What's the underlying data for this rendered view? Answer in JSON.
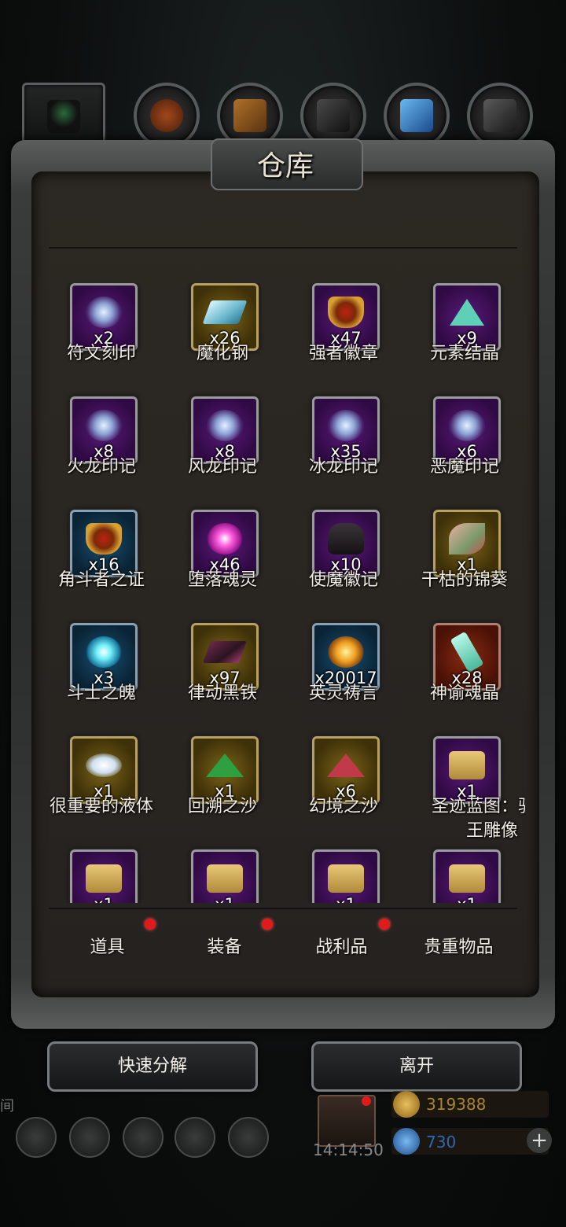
{
  "header": {
    "title": "仓库"
  },
  "top_tabs": [
    {
      "icon": "hooded-figure-icon"
    },
    {
      "icon": "leather-icon"
    },
    {
      "icon": "wood-icon"
    },
    {
      "icon": "iron-icon"
    },
    {
      "icon": "crystal-icon"
    },
    {
      "icon": "steel-icon"
    }
  ],
  "items": [
    {
      "name": "符文刻印",
      "count": "x2",
      "frame": "purple",
      "icon": "swirl"
    },
    {
      "name": "魔化钢",
      "count": "x26",
      "frame": "gold",
      "icon": "ingot"
    },
    {
      "name": "强者徽章",
      "count": "x47",
      "frame": "purple",
      "icon": "badge"
    },
    {
      "name": "元素结晶",
      "count": "x9",
      "frame": "purple",
      "icon": "pyramid"
    },
    {
      "name": "火龙印记",
      "count": "x8",
      "frame": "purple",
      "icon": "swirl"
    },
    {
      "name": "风龙印记",
      "count": "x8",
      "frame": "purple",
      "icon": "swirl"
    },
    {
      "name": "冰龙印记",
      "count": "x35",
      "frame": "purple",
      "icon": "swirl"
    },
    {
      "name": "恶魔印记",
      "count": "x6",
      "frame": "purple",
      "icon": "swirl"
    },
    {
      "name": "角斗者之证",
      "count": "x16",
      "frame": "blue",
      "icon": "badge"
    },
    {
      "name": "堕落魂灵",
      "count": "x46",
      "frame": "purple",
      "icon": "pinkorb"
    },
    {
      "name": "使魔徽记",
      "count": "x10",
      "frame": "purple",
      "icon": "dark"
    },
    {
      "name": "干枯的锦葵",
      "count": "x1",
      "frame": "gold",
      "icon": "leaf"
    },
    {
      "name": "斗士之魄",
      "count": "x3",
      "frame": "blue",
      "icon": "blueorb"
    },
    {
      "name": "律动黑铁",
      "count": "x97",
      "frame": "gold",
      "icon": "darkbar"
    },
    {
      "name": "英灵祷言",
      "count": "x20017",
      "frame": "blue",
      "icon": "sun"
    },
    {
      "name": "神谕魂晶",
      "count": "x28",
      "frame": "red",
      "icon": "crystal"
    },
    {
      "name": "很重要的液体",
      "count": "x1",
      "frame": "gold",
      "icon": "cloud"
    },
    {
      "name": "回溯之沙",
      "count": "x1",
      "frame": "gold",
      "icon": "sandg"
    },
    {
      "name": "幻境之沙",
      "count": "x6",
      "frame": "gold",
      "icon": "sandr"
    },
    {
      "name": "圣迹蓝图：骑士王雕像",
      "count": "x1",
      "frame": "purple",
      "icon": "scroll"
    },
    {
      "name": "",
      "count": "x1",
      "frame": "purple",
      "icon": "scroll"
    },
    {
      "name": "",
      "count": "x1",
      "frame": "purple",
      "icon": "scroll"
    },
    {
      "name": "",
      "count": "x1",
      "frame": "purple",
      "icon": "scroll"
    },
    {
      "name": "",
      "count": "x1",
      "frame": "purple",
      "icon": "scroll"
    }
  ],
  "category_tabs": [
    {
      "label": "道具",
      "badge": true
    },
    {
      "label": "装备",
      "badge": true
    },
    {
      "label": "战利品",
      "badge": true
    },
    {
      "label": "贵重物品",
      "badge": false
    }
  ],
  "actions": {
    "decompose": "快速分解",
    "leave": "离开"
  },
  "hud": {
    "time": "14:14:50",
    "gold": "319388",
    "gems": "730",
    "plus": "+",
    "side_text": "间",
    "gold_color": "#a8862a",
    "gem_color": "#2a6ab0"
  }
}
